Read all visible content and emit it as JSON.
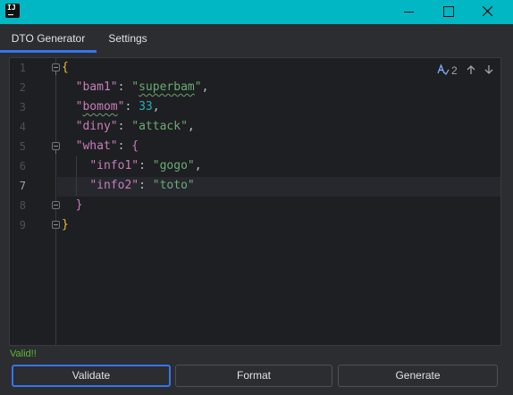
{
  "window": {
    "title": ""
  },
  "tabs": [
    {
      "label": "DTO Generator",
      "selected": true
    },
    {
      "label": "Settings",
      "selected": false
    }
  ],
  "editor": {
    "line_numbers": [
      "1",
      "2",
      "3",
      "4",
      "5",
      "6",
      "7",
      "8",
      "9"
    ],
    "current_line": "7",
    "inspection_count": "2",
    "lines": [
      "{",
      "  \"bam1\": \"superbam\",",
      "  \"bomom\": 33,",
      "  \"diny\": \"attack\",",
      "  \"what\": {",
      "    \"info1\": \"gogo\",",
      "    \"info2\": \"toto\"",
      "  }",
      "}"
    ]
  },
  "status": {
    "text": "Valid!!",
    "color": "#5fb832"
  },
  "buttons": {
    "validate": "Validate",
    "format": "Format",
    "generate": "Generate"
  },
  "colors": {
    "titlebar": "#00b7c3",
    "accent": "#3574f0",
    "string": "#6aab73",
    "key": "#c77dbb",
    "number": "#2aacb8",
    "brace": "#e8ba36"
  }
}
